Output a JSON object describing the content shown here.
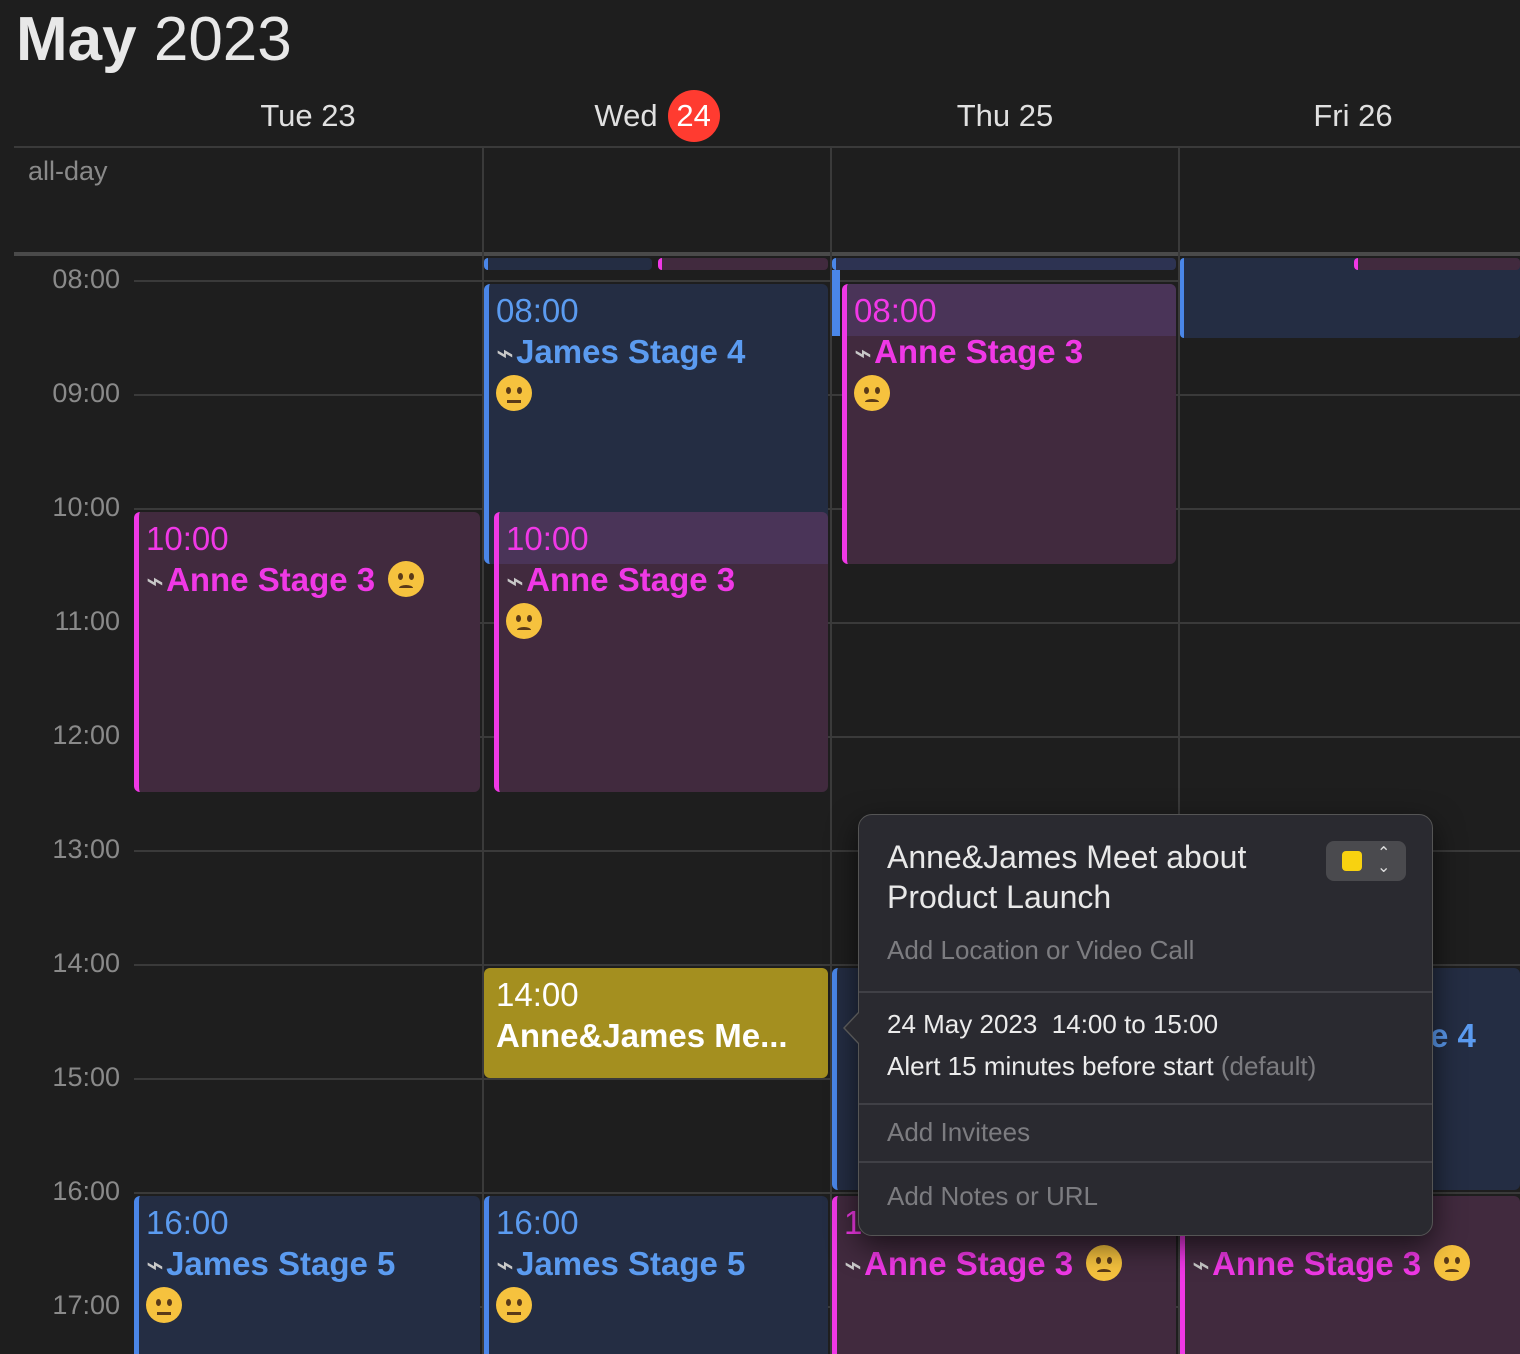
{
  "header": {
    "month": "May",
    "year": "2023"
  },
  "days": [
    {
      "label": "Tue 23"
    },
    {
      "label": "Wed",
      "badge": "24"
    },
    {
      "label": "Thu 25"
    },
    {
      "label": "Fri 26"
    }
  ],
  "allday_label": "all-day",
  "hours": [
    "08:00",
    "09:00",
    "10:00",
    "11:00",
    "12:00",
    "13:00",
    "14:00",
    "15:00",
    "16:00",
    "17:00"
  ],
  "events": {
    "wed_james4": {
      "time": "08:00",
      "title": "James Stage 4",
      "emoji": "weary-face-icon",
      "color": "#4a86e8"
    },
    "thu_anne3_am": {
      "time": "08:00",
      "title": "Anne Stage 3",
      "emoji": "worried-face-icon",
      "color": "#f038e6"
    },
    "tue_anne3": {
      "time": "10:00",
      "title": "Anne Stage 3",
      "emoji": "worried-face-icon",
      "color": "#f038e6"
    },
    "wed_anne3": {
      "time": "10:00",
      "title": "Anne Stage 3",
      "emoji": "worried-face-icon",
      "color": "#f038e6"
    },
    "wed_meet": {
      "time": "14:00",
      "title": "Anne&James Me...",
      "color": "#a48f1f"
    },
    "fri_partial": {
      "title": "e 4"
    },
    "tue_james5": {
      "time": "16:00",
      "title": "James Stage 5",
      "emoji": "crying-face-icon",
      "color": "#4a86e8"
    },
    "wed_james5": {
      "time": "16:00",
      "title": "James Stage 5",
      "emoji": "crying-face-icon",
      "color": "#4a86e8"
    },
    "thu_anne3_pm": {
      "time": "1",
      "title": "Anne Stage 3",
      "emoji": "worried-face-icon",
      "color": "#f038e6"
    },
    "fri_anne3_pm": {
      "title": "Anne Stage 3",
      "emoji": "worried-face-icon",
      "color": "#f038e6"
    }
  },
  "popover": {
    "title": "Anne&James Meet about Product Launch",
    "calendar_color": "#f8d210",
    "location_placeholder": "Add Location or Video Call",
    "date": "24 May 2023",
    "time_range": "14:00 to 15:00",
    "alert": "Alert 15 minutes before start",
    "alert_default": "(default)",
    "invitees_placeholder": "Add Invitees",
    "notes_placeholder": "Add Notes or URL"
  }
}
